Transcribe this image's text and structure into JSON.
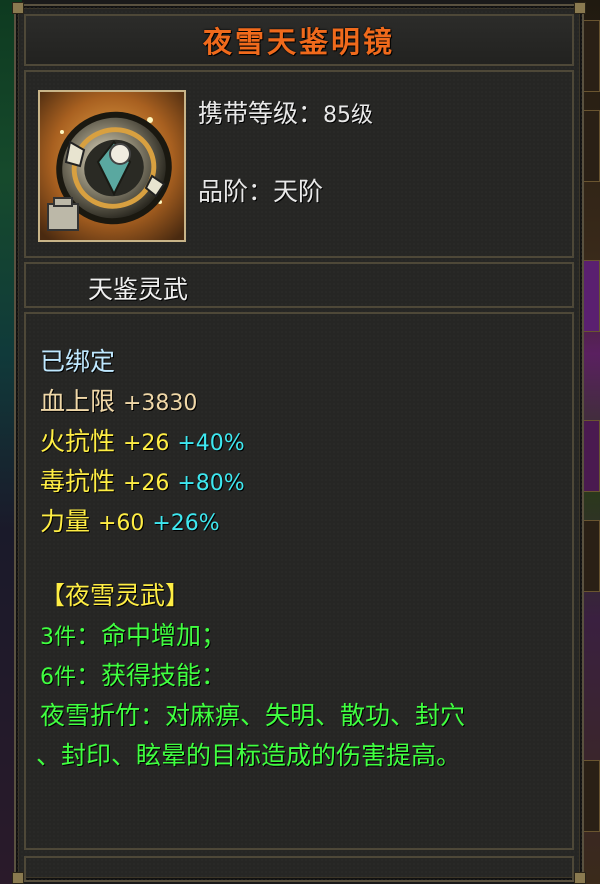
{
  "item": {
    "name": "夜雪天鉴明镜",
    "carry_level_label": "携带等级：",
    "carry_level_value": "85级",
    "grade_label": "品阶：",
    "grade_value": "天阶",
    "category": "天鉴灵武",
    "icon": "mirror-shield-icon"
  },
  "stats": {
    "bound": "已绑定",
    "hp": {
      "label": "血上限",
      "value": "+3830"
    },
    "fire_res": {
      "label": "火抗性",
      "value": "+26",
      "percent": "+40%"
    },
    "poison_res": {
      "label": "毒抗性",
      "value": "+26",
      "percent": "+80%"
    },
    "strength": {
      "label": "力量",
      "value": "+60",
      "percent": "+26%"
    }
  },
  "set": {
    "name": "【夜雪灵武】",
    "bonus_3_count": "3件",
    "bonus_3_text": "：命中增加；",
    "bonus_6_count": "6件",
    "bonus_6_text": "：获得技能：",
    "skill_line_1": "夜雪折竹：对麻痹、失明、散功、封穴",
    "skill_line_2": "、封印、眩晕的目标造成的伤害提高。"
  },
  "colors": {
    "title": "#f06a1c",
    "bound": "#bfe8ff",
    "hp": "#f0d8a8",
    "resist": "#ffee44",
    "percent": "#3ee8f0",
    "set": "#40ff40"
  }
}
